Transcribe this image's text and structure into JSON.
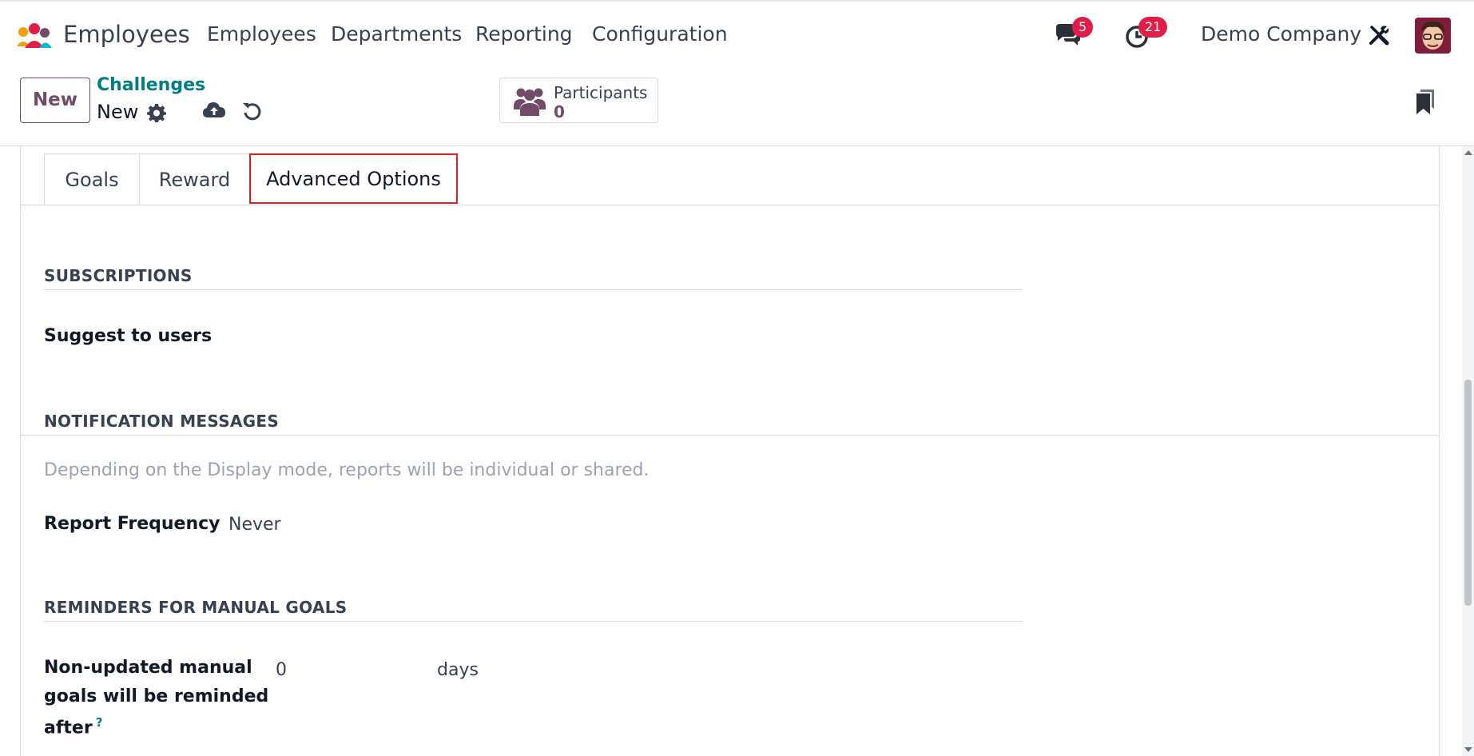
{
  "navbar": {
    "app_title": "Employees",
    "menu": [
      "Employees",
      "Departments",
      "Reporting",
      "Configuration"
    ],
    "messages_count": "5",
    "activities_count": "21",
    "company": "Demo Company",
    "icons": [
      "chat-icon",
      "clock-icon",
      "tools-icon"
    ]
  },
  "control": {
    "new_button": "New",
    "breadcrumb_parent": "Challenges",
    "breadcrumb_current": "New",
    "stat_button": {
      "label": "Participants",
      "value": "0"
    }
  },
  "tabs": [
    "Goals",
    "Reward",
    "Advanced Options"
  ],
  "active_tab": "Advanced Options",
  "sections": {
    "subscriptions": {
      "title": "SUBSCRIPTIONS",
      "suggest_label": "Suggest to users"
    },
    "notifications": {
      "title": "NOTIFICATION MESSAGES",
      "help": "Depending on the Display mode, reports will be individual or shared.",
      "frequency_label": "Report Frequency",
      "frequency_value": "Never"
    },
    "reminders": {
      "title": "REMINDERS FOR MANUAL GOALS",
      "label_line1": "Non-updated manual",
      "label_line2": "goals will be reminded",
      "label_line3": "after",
      "help_mark": "?",
      "value": "0",
      "unit": "days"
    }
  },
  "colors": {
    "brand": "#714b67",
    "link": "#017e84",
    "badge": "#e11d48",
    "highlight": "#e02020"
  }
}
